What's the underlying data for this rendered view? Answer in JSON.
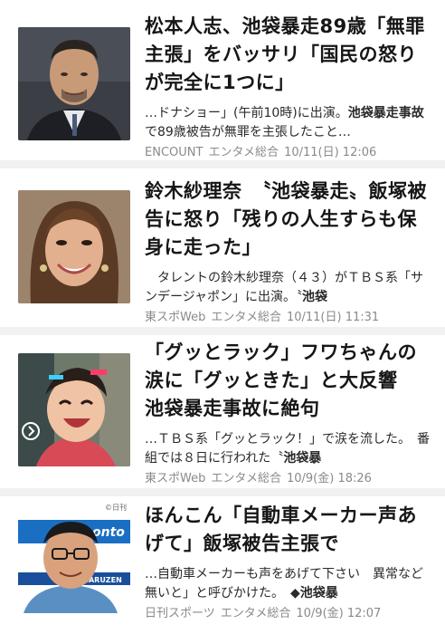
{
  "articles": [
    {
      "headline": "松本人志、池袋暴走89歳「無罪主張」をバッサリ「国民の怒りが完全に1つに」",
      "snippet_pre": "…ドナショー」(午前10時)に出演。",
      "snippet_bold": "池袋暴走事故",
      "snippet_post": "で89歳被告が無罪を主張したこと…",
      "source": "ENCOUNT",
      "category": "エンタメ総合",
      "date": "10/11(日) 12:06",
      "thumbnail_icon": "person-photo-icon"
    },
    {
      "headline": "鈴木紗理奈　〝池袋暴走〟飯塚被告に怒り「残りの人生すらも保身に走った」",
      "snippet_pre": "　タレントの鈴木紗理奈（４３）がＴＢＳ系「サンデージャポン」に出演。〝",
      "snippet_bold": "池袋",
      "snippet_post": "",
      "source": "東スポWeb",
      "category": "エンタメ総合",
      "date": "10/11(日) 11:31",
      "thumbnail_icon": "person-photo-icon"
    },
    {
      "headline": "「グッとラック」フワちゃんの涙に「グッときた」と大反響　池袋暴走事故に絶句",
      "snippet_pre": "…ＴＢＳ系「グッとラック！」で涙を流した。　番組では８日に行われた〝",
      "snippet_bold": "池袋暴",
      "snippet_post": "",
      "source": "東スポWeb",
      "category": "エンタメ総合",
      "date": "10/9(金) 18:26",
      "thumbnail_icon": "person-photo-icon"
    },
    {
      "headline": "ほんこん「自動車メーカー声あげて」飯塚被告主張で",
      "snippet_pre": "…自動車メーカーも声をあげて下さい　異常など無いと」と呼びかけた。　◆",
      "snippet_bold": "池袋暴",
      "snippet_post": "",
      "source": "日刊スポーツ",
      "category": "エンタメ総合",
      "date": "10/9(金) 12:07",
      "thumbnail_icon": "person-photo-icon",
      "photo_credit": "©日刊",
      "backdrop_text": "MARUZEN"
    }
  ],
  "colors": {
    "divider": "#f1f1f3",
    "meta_text": "#8a8a8a",
    "headline_text": "#161616"
  }
}
